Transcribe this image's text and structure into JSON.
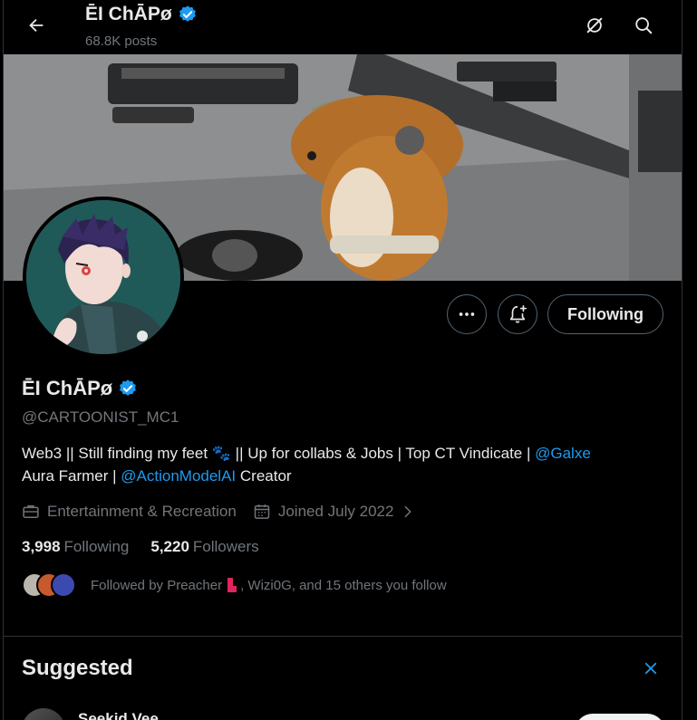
{
  "header": {
    "display_name": "ĒI ChĀPø",
    "posts_count": "68.8K posts"
  },
  "profile": {
    "display_name": "ĒI ChĀPø",
    "handle": "@CARTOONIST_MC1",
    "bio": {
      "part1": "Web3 || Still finding my feet ",
      "emoji": "🐾",
      "part2": " || Up for collabs & Jobs | Top CT Vindicate  | ",
      "mention1": "@Galxe",
      "part3": "Aura Farmer | ",
      "mention2": "@ActionModelAI",
      "part4": " Creator"
    },
    "category": "Entertainment & Recreation",
    "joined": "Joined July 2022",
    "following_count": "3,998",
    "following_label": "Following",
    "followers_count": "5,220",
    "followers_label": "Followers",
    "followed_by": {
      "prefix": "Followed by Preacher",
      "suffix": ", Wizi0G, and 15 others you follow"
    }
  },
  "actions": {
    "following_button": "Following"
  },
  "suggested": {
    "title": "Suggested",
    "first_name": "Seekid Vee"
  },
  "colors": {
    "accent": "#1d9bf0",
    "background": "#000000",
    "muted": "#71767b",
    "border": "#2f3336"
  }
}
